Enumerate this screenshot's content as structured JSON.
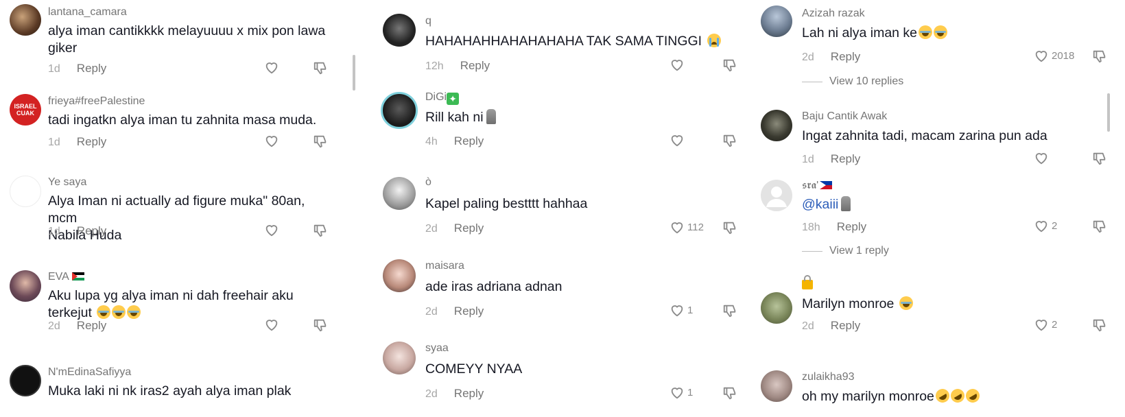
{
  "reply_label": "Reply",
  "columns": [
    {
      "comments": [
        {
          "username": "lantana_camara",
          "text_line1": "alya iman cantikkkk melayuuuu x mix pon lawa",
          "text_line2": "giker",
          "time": "1d"
        },
        {
          "username": "frieya#freePalestine",
          "text": "tadi ingatkn alya iman tu zahnita masa muda.",
          "time": "1d",
          "avatar_text": "ISRAEL CUAK"
        },
        {
          "username": "Ye saya",
          "text_line1": "Alya Iman ni actually ad figure muka\" 80an, mcm",
          "text_line2": "Nabila Huda",
          "time": "1d"
        },
        {
          "username": "EVA",
          "text_line1": "Aku lupa yg alya iman ni dah freehair aku",
          "text_line2": "terkejut",
          "time": "2d"
        },
        {
          "username": "N'mEdinaSafiyya",
          "text": "Muka laki ni nk iras2 ayah alya iman plak"
        }
      ]
    },
    {
      "comments": [
        {
          "username": "q",
          "text": "HAHAHAHHAHAHAHAHA TAK SAMA TINGGI",
          "time": "12h"
        },
        {
          "username": "DiGi",
          "text": "Rill kah ni",
          "time": "4h"
        },
        {
          "username": "ò",
          "text": "Kapel paling bestttt hahhaa",
          "time": "2d",
          "likes": "112"
        },
        {
          "username": "maisara",
          "text": "ade iras adriana adnan",
          "time": "2d",
          "likes": "1"
        },
        {
          "username": "syaa",
          "text": "COMEYY NYAA",
          "time": "2d",
          "likes": "1"
        }
      ]
    },
    {
      "comments": [
        {
          "username": "Azizah razak",
          "text": "Lah ni alya iman ke",
          "time": "2d",
          "likes": "2018",
          "view_replies": "View 10 replies"
        },
        {
          "username": "Baju Cantik Awak",
          "text": "Ingat zahnita tadi, macam zarina pun ada",
          "time": "1d"
        },
        {
          "username": "𝖘𝖗𝖆'",
          "mention": "@kaiii",
          "time": "18h",
          "likes": "2",
          "view_replies": "View 1 reply"
        },
        {
          "username": "",
          "text": "Marilyn monroe",
          "time": "2d",
          "likes": "2"
        },
        {
          "username": "zulaikha93",
          "text": "oh my marilyn monroe"
        }
      ]
    }
  ],
  "colors": {
    "text": "#161823",
    "muted": "#757575",
    "mention": "#2b5db9",
    "time": "#a6a6a6"
  }
}
